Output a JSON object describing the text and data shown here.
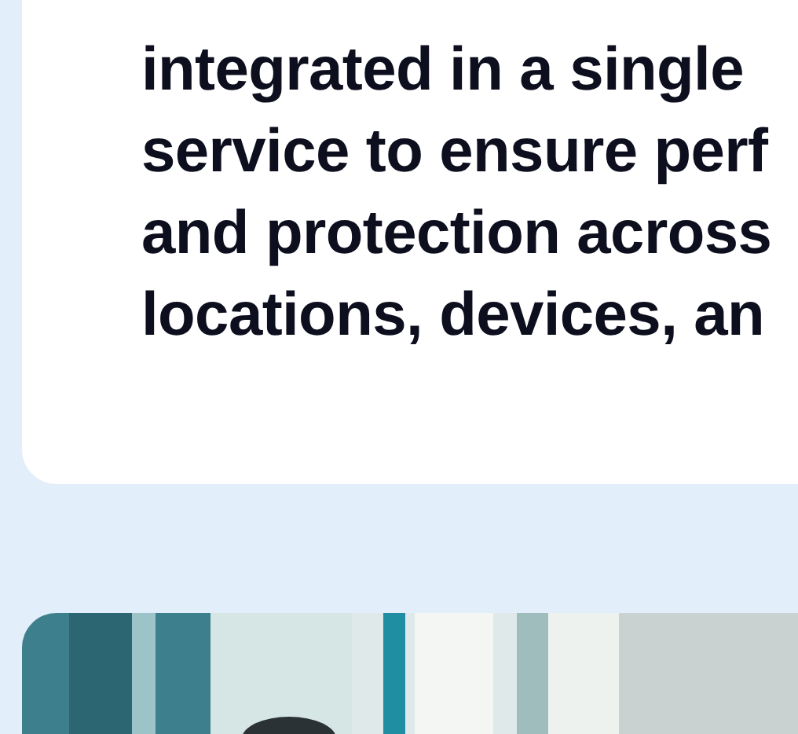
{
  "card": {
    "lines": [
      "integrated in a single",
      "service to ensure perf",
      "and protection across",
      "locations, devices, an"
    ]
  }
}
